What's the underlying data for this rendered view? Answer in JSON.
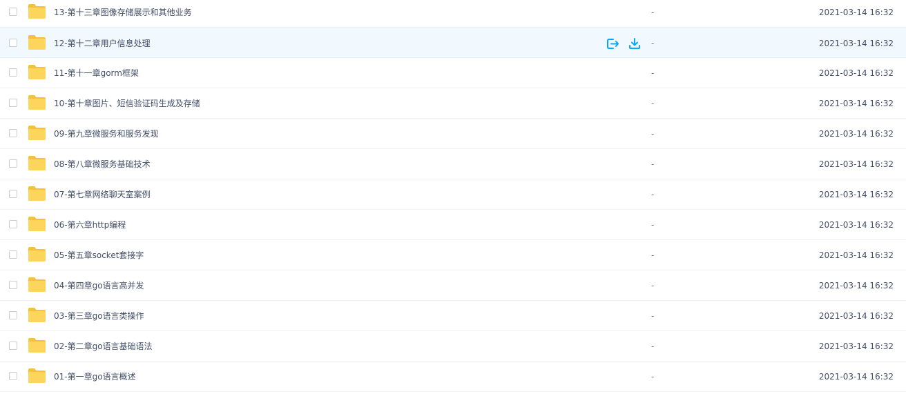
{
  "colors": {
    "folder_body": "#fdd45c",
    "folder_tab": "#f5c13b",
    "accent": "#06a7ff",
    "hover_bg": "#f1f9fe"
  },
  "hovered_row_index": 1,
  "row_actions": [
    {
      "name": "share-icon"
    },
    {
      "name": "download-icon"
    }
  ],
  "files": [
    {
      "name": "13-第十三章图像存储展示和其他业务",
      "size": "-",
      "modified": "2021-03-14 16:32"
    },
    {
      "name": "12-第十二章用户信息处理",
      "size": "-",
      "modified": "2021-03-14 16:32"
    },
    {
      "name": "11-第十一章gorm框架",
      "size": "-",
      "modified": "2021-03-14 16:32"
    },
    {
      "name": "10-第十章图片、短信验证码生成及存储",
      "size": "-",
      "modified": "2021-03-14 16:32"
    },
    {
      "name": "09-第九章微服务和服务发现",
      "size": "-",
      "modified": "2021-03-14 16:32"
    },
    {
      "name": "08-第八章微服务基础技术",
      "size": "-",
      "modified": "2021-03-14 16:32"
    },
    {
      "name": "07-第七章网络聊天室案例",
      "size": "-",
      "modified": "2021-03-14 16:32"
    },
    {
      "name": "06-第六章http编程",
      "size": "-",
      "modified": "2021-03-14 16:32"
    },
    {
      "name": "05-第五章socket套接字",
      "size": "-",
      "modified": "2021-03-14 16:32"
    },
    {
      "name": "04-第四章go语言高并发",
      "size": "-",
      "modified": "2021-03-14 16:32"
    },
    {
      "name": "03-第三章go语言类操作",
      "size": "-",
      "modified": "2021-03-14 16:32"
    },
    {
      "name": "02-第二章go语言基础语法",
      "size": "-",
      "modified": "2021-03-14 16:32"
    },
    {
      "name": "01-第一章go语言概述",
      "size": "-",
      "modified": "2021-03-14 16:32"
    }
  ]
}
